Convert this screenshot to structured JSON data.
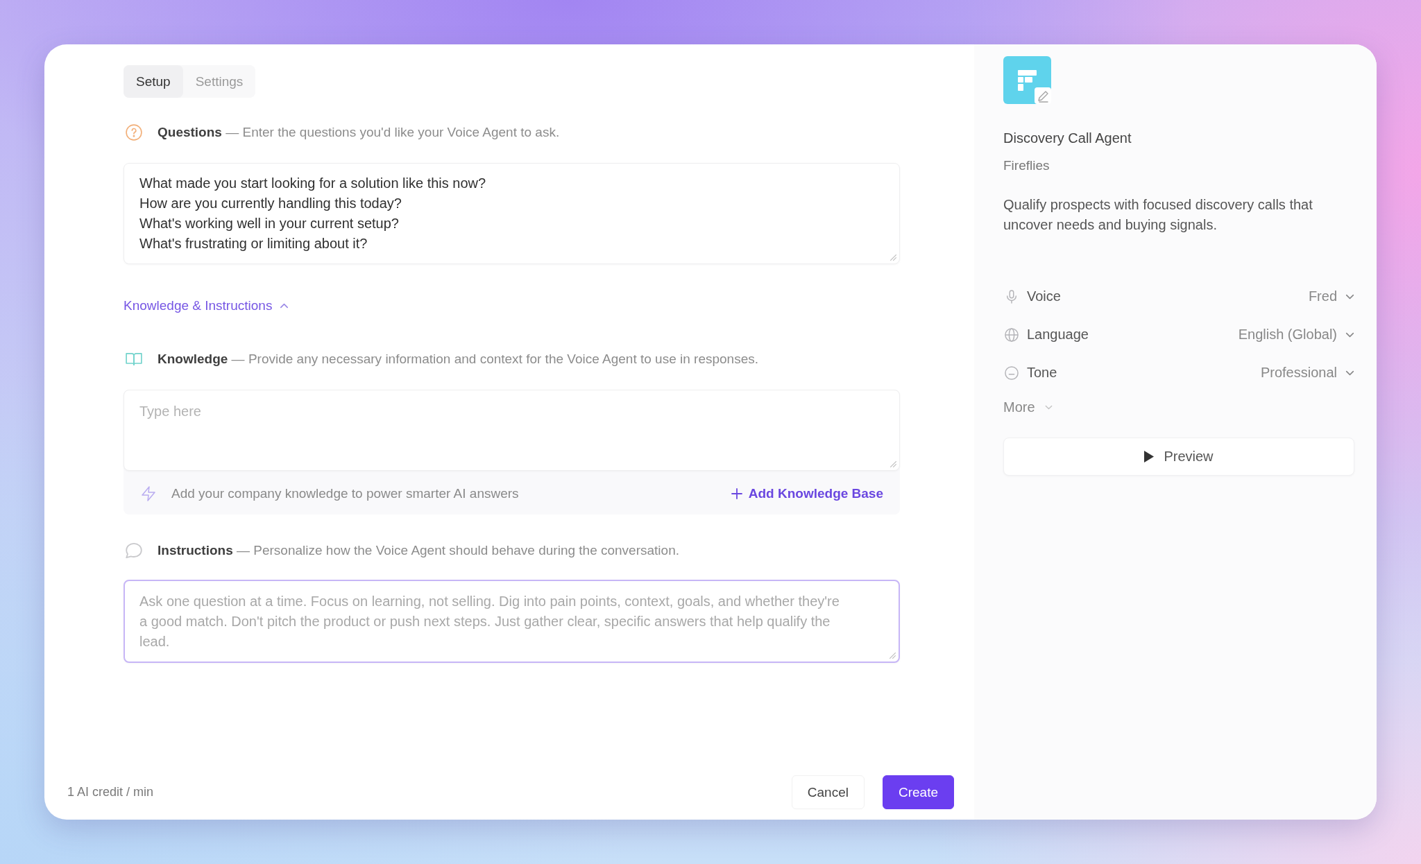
{
  "tabs": [
    {
      "label": "Setup",
      "selected": true
    },
    {
      "label": "Settings",
      "selected": false
    }
  ],
  "questions": {
    "heading": "**Questions** — Enter the questions you'd like your Voice Agent to ask.",
    "value": "What made you start looking for a solution like this now?\nHow are you currently handling this today?\nWhat's working well in your current setup?\nWhat's frustrating or limiting about it?"
  },
  "knowledge_toggle": {
    "label": "Knowledge & Instructions",
    "expanded": true
  },
  "knowledge": {
    "heading": "**Knowledge** — Provide any necessary information and context for the Voice Agent to use in responses.",
    "placeholder": "Type here",
    "hint": "Add your company knowledge to power smarter AI answers",
    "action": "Add Knowledge Base"
  },
  "instructions": {
    "heading": "**Instructions** — Personalize how the Voice Agent should behave during the conversation.",
    "placeholder": "Ask one question at a time. Focus on learning, not selling. Dig into pain points, context, goals, and whether they're a good match. Don't pitch the product or push next steps. Just gather clear, specific answers that help qualify the lead.",
    "focused": true
  },
  "footer": {
    "credits": "1 AI credit / min",
    "buttons": [
      {
        "label": "Cancel",
        "kind": "secondary"
      },
      {
        "label": "Create",
        "kind": "primary"
      }
    ]
  },
  "agent": {
    "name": "Discovery Call Agent",
    "company": "Fireflies",
    "description": "Qualify prospects with focused discovery calls that uncover needs and buying signals.",
    "settings": [
      {
        "kind": "voice",
        "label": "Voice",
        "value": "Fred"
      },
      {
        "kind": "language",
        "label": "Language",
        "value": "English (Global)"
      },
      {
        "kind": "tone",
        "label": "Tone",
        "value": "Professional"
      }
    ],
    "more": {
      "label": "More",
      "expanded": false
    },
    "preview": "Preview"
  }
}
